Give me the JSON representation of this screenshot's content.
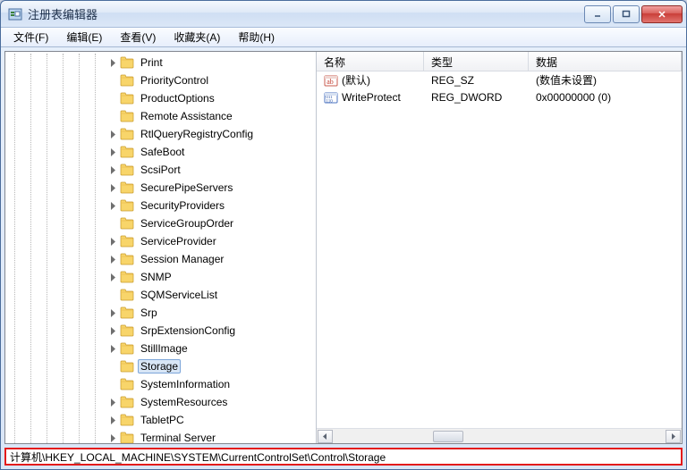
{
  "window": {
    "title": "注册表编辑器"
  },
  "menus": {
    "file": "文件(F)",
    "edit": "编辑(E)",
    "view": "查看(V)",
    "favorites": "收藏夹(A)",
    "help": "帮助(H)"
  },
  "tree": {
    "selected": "Storage",
    "items": [
      {
        "label": "Print",
        "expandable": true
      },
      {
        "label": "PriorityControl",
        "expandable": false
      },
      {
        "label": "ProductOptions",
        "expandable": false
      },
      {
        "label": "Remote Assistance",
        "expandable": false
      },
      {
        "label": "RtlQueryRegistryConfig",
        "expandable": true
      },
      {
        "label": "SafeBoot",
        "expandable": true
      },
      {
        "label": "ScsiPort",
        "expandable": true
      },
      {
        "label": "SecurePipeServers",
        "expandable": true
      },
      {
        "label": "SecurityProviders",
        "expandable": true
      },
      {
        "label": "ServiceGroupOrder",
        "expandable": false
      },
      {
        "label": "ServiceProvider",
        "expandable": true
      },
      {
        "label": "Session Manager",
        "expandable": true
      },
      {
        "label": "SNMP",
        "expandable": true
      },
      {
        "label": "SQMServiceList",
        "expandable": false
      },
      {
        "label": "Srp",
        "expandable": true
      },
      {
        "label": "SrpExtensionConfig",
        "expandable": true
      },
      {
        "label": "StillImage",
        "expandable": true
      },
      {
        "label": "Storage",
        "expandable": false,
        "selected": true
      },
      {
        "label": "SystemInformation",
        "expandable": false
      },
      {
        "label": "SystemResources",
        "expandable": true
      },
      {
        "label": "TabletPC",
        "expandable": true
      },
      {
        "label": "Terminal Server",
        "expandable": true
      }
    ]
  },
  "list": {
    "columns": {
      "name": "名称",
      "type": "类型",
      "data": "数据"
    },
    "col_widths": {
      "name": 120,
      "type": 117,
      "data": 160
    },
    "rows": [
      {
        "icon": "string",
        "name": "(默认)",
        "type": "REG_SZ",
        "data": "(数值未设置)"
      },
      {
        "icon": "binary",
        "name": "WriteProtect",
        "type": "REG_DWORD",
        "data": "0x00000000 (0)"
      }
    ]
  },
  "statusbar": {
    "path": "计算机\\HKEY_LOCAL_MACHINE\\SYSTEM\\CurrentControlSet\\Control\\Storage"
  }
}
